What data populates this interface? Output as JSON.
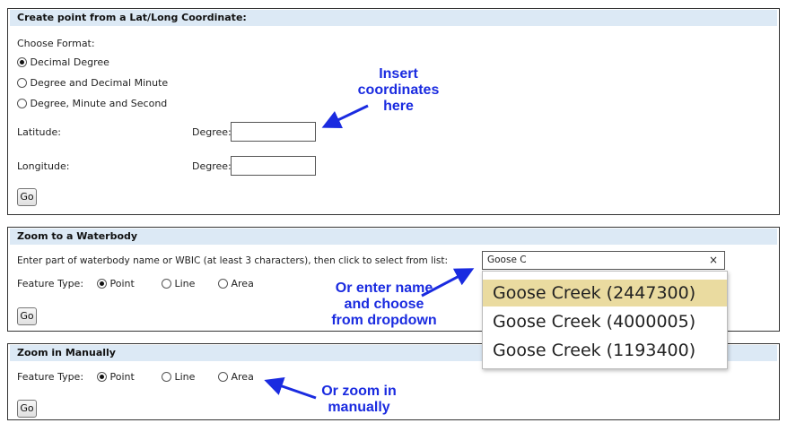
{
  "panel1": {
    "title": "Create point from a Lat/Long Coordinate:",
    "choose_format_label": "Choose Format:",
    "formats": [
      {
        "label": "Decimal Degree",
        "checked": true
      },
      {
        "label": "Degree and Decimal Minute",
        "checked": false
      },
      {
        "label": "Degree, Minute and Second",
        "checked": false
      }
    ],
    "latitude_label": "Latitude:",
    "longitude_label": "Longitude:",
    "degree_label": "Degree:",
    "latitude_value": "",
    "longitude_value": "",
    "go_label": "Go"
  },
  "panel2": {
    "title": "Zoom to a Waterbody",
    "instruction": "Enter part of waterbody name or WBIC (at least 3 characters), then click to select from list:",
    "search_value": "Goose C",
    "clear_glyph": "×",
    "feature_type_label": "Feature Type:",
    "feature_types": [
      {
        "label": "Point",
        "checked": true
      },
      {
        "label": "Line",
        "checked": false
      },
      {
        "label": "Area",
        "checked": false
      }
    ],
    "go_label": "Go",
    "dropdown_options": [
      "Goose Creek (2447300)",
      "Goose Creek (4000005)",
      "Goose Creek (1193400)"
    ]
  },
  "panel3": {
    "title": "Zoom in Manually",
    "feature_type_label": "Feature Type:",
    "feature_types": [
      {
        "label": "Point",
        "checked": true
      },
      {
        "label": "Line",
        "checked": false
      },
      {
        "label": "Area",
        "checked": false
      }
    ],
    "go_label": "Go"
  },
  "annotations": {
    "insert_coords": [
      "Insert",
      "coordinates",
      "here"
    ],
    "enter_name": [
      "Or enter name",
      "and choose",
      "from dropdown"
    ],
    "zoom_manually": [
      "Or zoom in",
      "manually"
    ]
  },
  "colors": {
    "annotation": "#1a2be0",
    "header_bg": "#dce9f5",
    "highlight": "#eadba0"
  }
}
